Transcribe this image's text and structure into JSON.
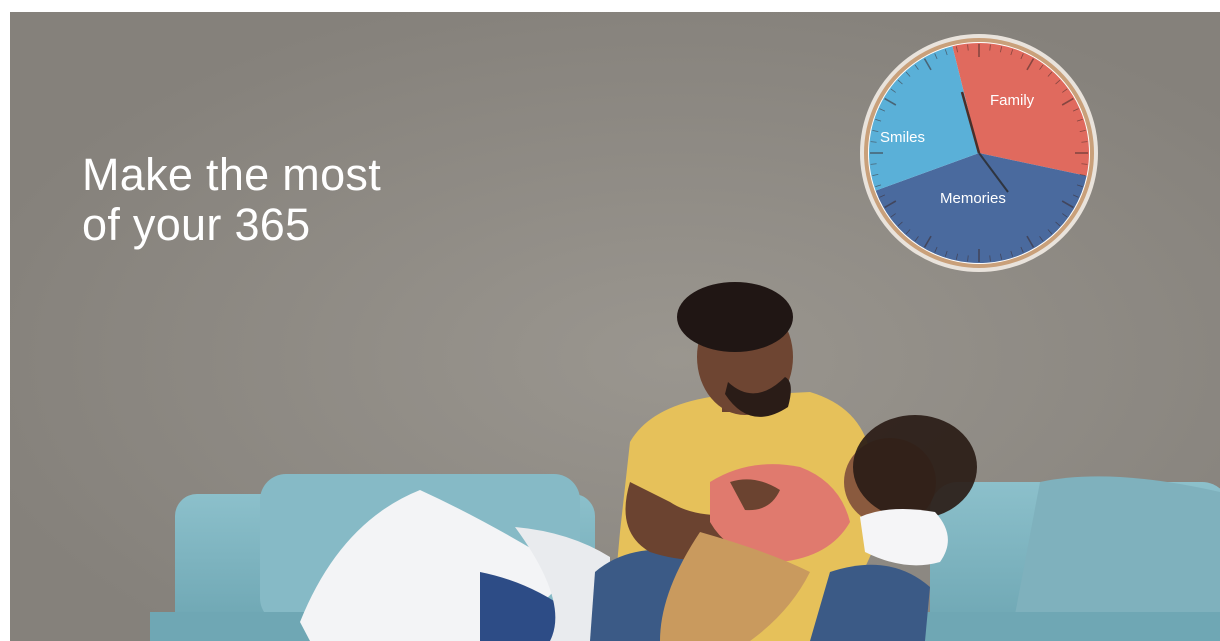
{
  "headline": {
    "line1": "Make the most",
    "line2": "of your 365"
  },
  "clock": {
    "segments": [
      {
        "label": "Family",
        "color": "#e06a5e"
      },
      {
        "label": "Smiles",
        "color": "#5ab0d8"
      },
      {
        "label": "Memories",
        "color": "#4a6a9e"
      }
    ],
    "rim_color": "#c9a07a"
  },
  "colors": {
    "wall": "#8a8680",
    "sofa": "#7fb3bf",
    "shirt_adult": "#e6c15a",
    "shirt_child": "#e07a6e",
    "jeans": "#3b5a86",
    "pillow": "#f2f3f5"
  }
}
